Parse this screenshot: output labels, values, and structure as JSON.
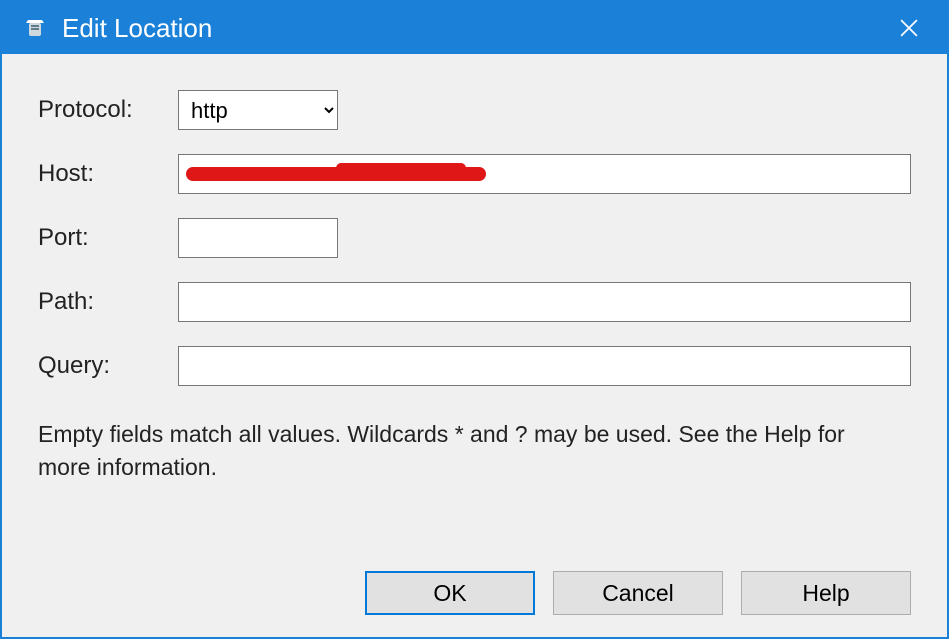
{
  "titlebar": {
    "title": "Edit Location"
  },
  "labels": {
    "protocol": "Protocol:",
    "host": "Host:",
    "port": "Port:",
    "path": "Path:",
    "query": "Query:"
  },
  "fields": {
    "protocol_selected": "http",
    "protocol_options": [
      "http"
    ],
    "host": "",
    "port": "",
    "path": "",
    "query": ""
  },
  "hint": "Empty fields match all values. Wildcards * and ? may be used. See the Help for more information.",
  "buttons": {
    "ok": "OK",
    "cancel": "Cancel",
    "help": "Help"
  }
}
